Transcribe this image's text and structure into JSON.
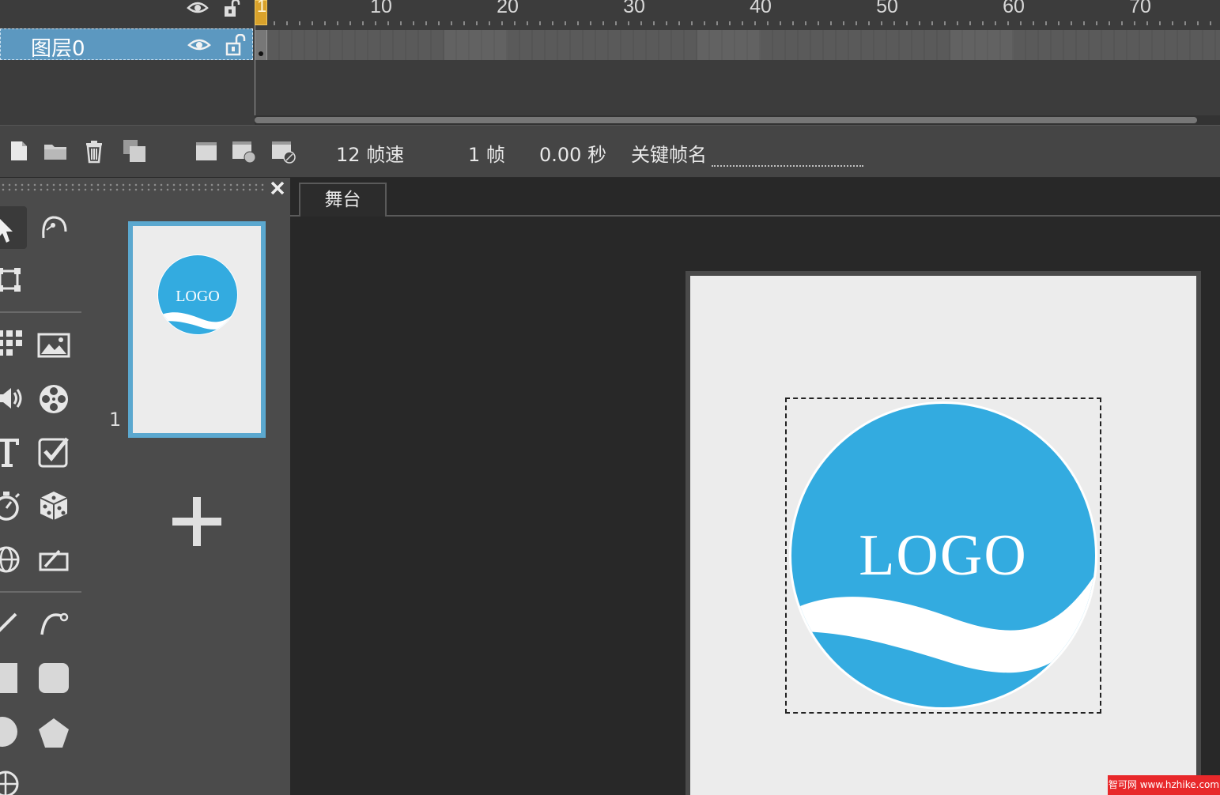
{
  "timeline": {
    "current_frame_marker": "1",
    "ruler_labels": [
      "10",
      "20",
      "30",
      "40",
      "50",
      "60",
      "70"
    ],
    "layers": [
      {
        "name": "图层0"
      }
    ]
  },
  "toolbar": {
    "fps_value": "12",
    "fps_label": "帧速",
    "frame_value": "1",
    "frame_label": "帧",
    "time_value": "0.00",
    "time_label": "秒",
    "keyframe_name_label": "关键帧名",
    "keyframe_name_value": ""
  },
  "pages": {
    "items": [
      {
        "number": "1",
        "thumb_logo_text": "LOGO"
      }
    ]
  },
  "stage": {
    "tab_label": "舞台",
    "logo_text": "LOGO",
    "logo_color": "#33abe0",
    "canvas_color": "#ececec"
  },
  "watermark": {
    "text": "智可网 www.hzhike.com"
  },
  "colors": {
    "selection_blue": "#5ba8cf",
    "playhead": "#d9a22b",
    "panel_bg": "#4b4b4b",
    "stage_bg": "#282828"
  }
}
